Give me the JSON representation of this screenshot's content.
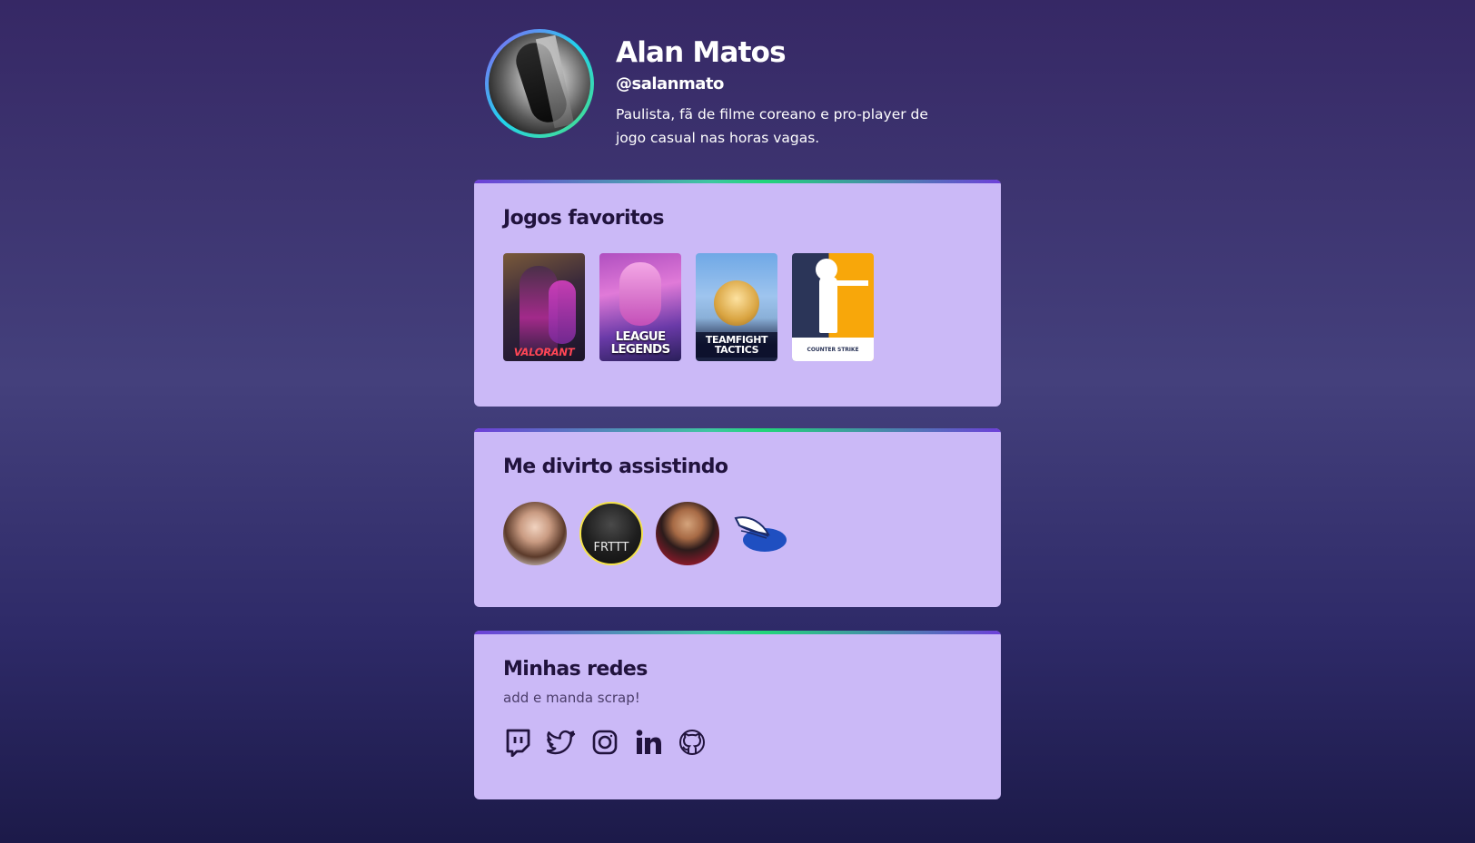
{
  "profile": {
    "name": "Alan Matos",
    "handle": "@salanmato",
    "bio": "Paulista, fã de filme coreano e pro-player de jogo casual nas horas vagas."
  },
  "favorite_games": {
    "title": "Jogos favoritos",
    "items": [
      {
        "name": "Valorant",
        "label": "VALORANT"
      },
      {
        "name": "League of Legends",
        "label_line1": "LEAGUE",
        "label_line2": "LEGENDS"
      },
      {
        "name": "Teamfight Tactics",
        "label_line1": "TEAMFIGHT",
        "label_line2": "TACTICS"
      },
      {
        "name": "Counter-Strike",
        "label": "COUNTER STRIKE"
      }
    ]
  },
  "watching": {
    "title": "Me divirto assistindo",
    "items": [
      {
        "name": "streamer-1"
      },
      {
        "name": "streamer-2",
        "label": "FRTTT"
      },
      {
        "name": "streamer-3"
      },
      {
        "name": "streamer-4"
      }
    ]
  },
  "networks": {
    "title": "Minhas redes",
    "subtitle": "add e manda scrap!",
    "items": [
      {
        "icon": "twitch-icon"
      },
      {
        "icon": "twitter-icon"
      },
      {
        "icon": "instagram-icon"
      },
      {
        "icon": "linkedin-icon"
      },
      {
        "icon": "github-icon"
      }
    ]
  },
  "colors": {
    "card_bg": "#cbb9f7",
    "heading": "#21133d",
    "accent_gradient": [
      "#6d3fd9",
      "#22d67a"
    ]
  }
}
